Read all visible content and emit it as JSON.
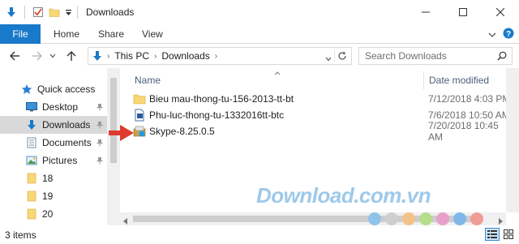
{
  "window": {
    "title": "Downloads"
  },
  "ribbon": {
    "tabs": [
      "File",
      "Home",
      "Share",
      "View"
    ]
  },
  "address": {
    "crumbs": [
      "This PC",
      "Downloads"
    ],
    "search_placeholder": "Search Downloads"
  },
  "nav": {
    "items": [
      {
        "label": "Quick access",
        "icon": "star-icon"
      },
      {
        "label": "Desktop",
        "icon": "desktop-icon"
      },
      {
        "label": "Downloads",
        "icon": "download-arrow-icon"
      },
      {
        "label": "Documents",
        "icon": "documents-icon"
      },
      {
        "label": "Pictures",
        "icon": "pictures-icon"
      },
      {
        "label": "18",
        "icon": "folder-icon"
      },
      {
        "label": "19",
        "icon": "folder-icon"
      },
      {
        "label": "20",
        "icon": "folder-icon"
      }
    ]
  },
  "columns": {
    "name": "Name",
    "date": "Date modified"
  },
  "files": [
    {
      "name": "Bieu mau-thong-tu-156-2013-tt-bt",
      "date": "7/12/2018 4:03 PM",
      "icon": "folder-icon"
    },
    {
      "name": "Phu-luc-thong-tu-1332016tt-btc",
      "date": "7/6/2018 10:50 AM",
      "icon": "document-icon"
    },
    {
      "name": "Skype-8.25.0.5",
      "date": "7/20/2018 10:45 AM",
      "icon": "installer-icon"
    }
  ],
  "status": {
    "items_count": "3 items"
  },
  "watermark": {
    "text": "Download.com.vn"
  },
  "colors": {
    "accent": "#1979ca",
    "arrow": "#e03a2f",
    "folder": "#f8d775"
  }
}
